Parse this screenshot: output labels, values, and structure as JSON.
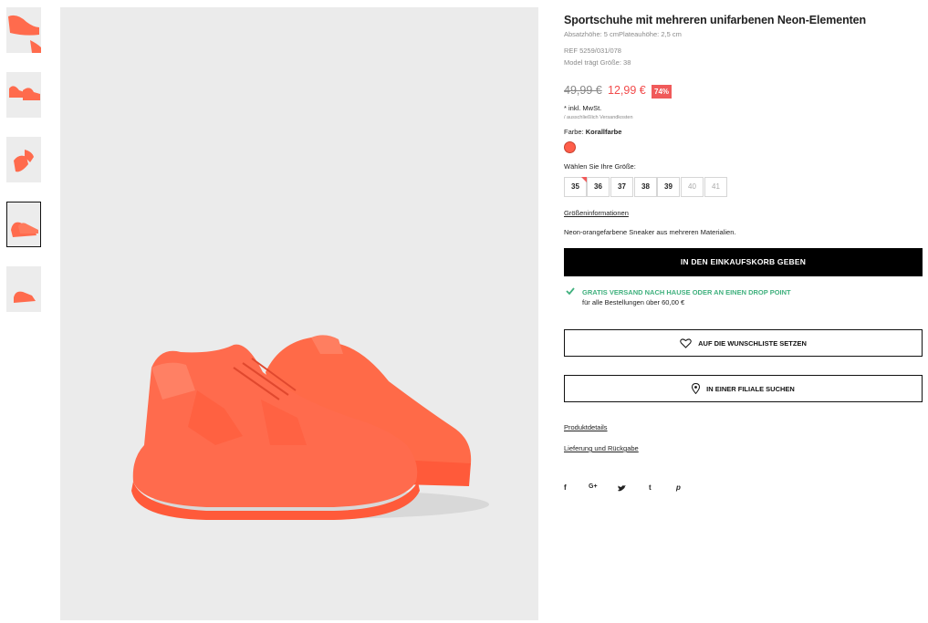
{
  "gallery": {
    "thumbnails": [
      {
        "label": "thumb-1"
      },
      {
        "label": "thumb-2"
      },
      {
        "label": "thumb-3"
      },
      {
        "label": "thumb-4",
        "selected": true
      },
      {
        "label": "thumb-5"
      }
    ]
  },
  "product": {
    "title": "Sportschuhe mit mehreren unifarbenen Neon-Elementen",
    "heights": "Absatzhöhe: 5 cmPlateauhöhe: 2,5 cm",
    "ref": "REF 5259/031/078",
    "model_size": "Model trägt Größe: 38",
    "old_price": "49,99 €",
    "new_price": "12,99 €",
    "discount": "74%",
    "tax_note": "* inkl. MwSt.",
    "shipping_note": "/ ausschließlich Versandkosten",
    "color_label": "Farbe: ",
    "color_value": "Korallfarbe",
    "color_hex": "#ff5e4a",
    "size_prompt": "Wählen Sie Ihre Größe:",
    "sizes": [
      {
        "label": "35",
        "available": true,
        "low_stock": true
      },
      {
        "label": "36",
        "available": true
      },
      {
        "label": "37",
        "available": true
      },
      {
        "label": "38",
        "available": true
      },
      {
        "label": "39",
        "available": true
      },
      {
        "label": "40",
        "available": false
      },
      {
        "label": "41",
        "available": false
      }
    ],
    "size_info_link": "Größeninformationen",
    "description": "Neon-orangefarbene Sneaker aus mehreren Materialien."
  },
  "actions": {
    "add_to_cart": "IN DEN EINKAUFSKORB GEBEN",
    "shipping_line1": "GRATIS VERSAND NACH HAUSE ODER AN EINEN DROP POINT",
    "shipping_line2": "für alle Bestellungen über 60,00 €",
    "wishlist": "AUF DIE WUNSCHLISTE SETZEN",
    "store": "IN EINER FILIALE SUCHEN"
  },
  "links": {
    "details": "Produktdetails",
    "delivery": "Lieferung und Rückgabe"
  },
  "social": {
    "facebook": "f",
    "googleplus": "G+",
    "twitter": "t-bird",
    "tumblr": "t",
    "pinterest": "p"
  },
  "colors": {
    "accent": "#f05a5a",
    "shoe": "#ff6b4d",
    "shipping_green": "#3fb07d"
  }
}
